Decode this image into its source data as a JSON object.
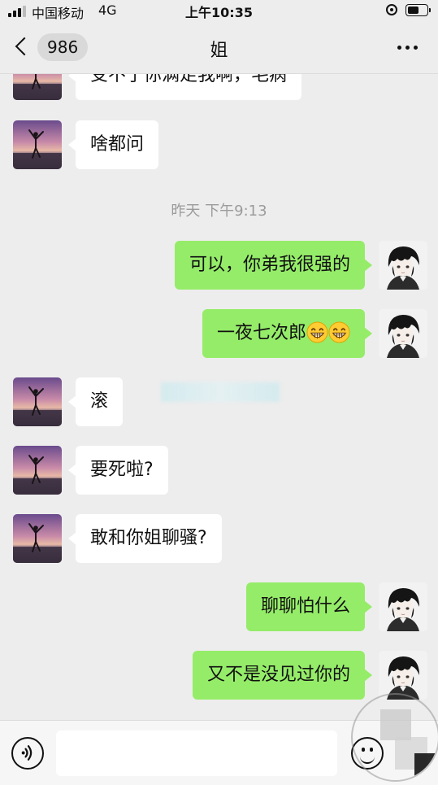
{
  "status_bar": {
    "carrier": "中国移动",
    "network": "4G",
    "time": "上午10:35"
  },
  "nav": {
    "unread_count": "986",
    "title": "姐"
  },
  "messages": {
    "m0": "受不了你满足我啊，毛病",
    "m1": "啥都问",
    "timestamp": "昨天 下午9:13",
    "m2": "可以，你弟我很强的",
    "m3": "一夜七次郎",
    "m4": "滚",
    "m5": "要死啦?",
    "m6": "敢和你姐聊骚?",
    "m7": "聊聊怕什么",
    "m8": "又不是没见过你的"
  },
  "icons": {
    "m3_trailing": [
      "grinning-face-emoji",
      "grinning-face-emoji"
    ]
  },
  "colors": {
    "background": "#ededed",
    "sent_bubble": "#95ec69",
    "received_bubble": "#ffffff",
    "timestamp_text": "#9b9b9b"
  },
  "input": {
    "value": ""
  }
}
